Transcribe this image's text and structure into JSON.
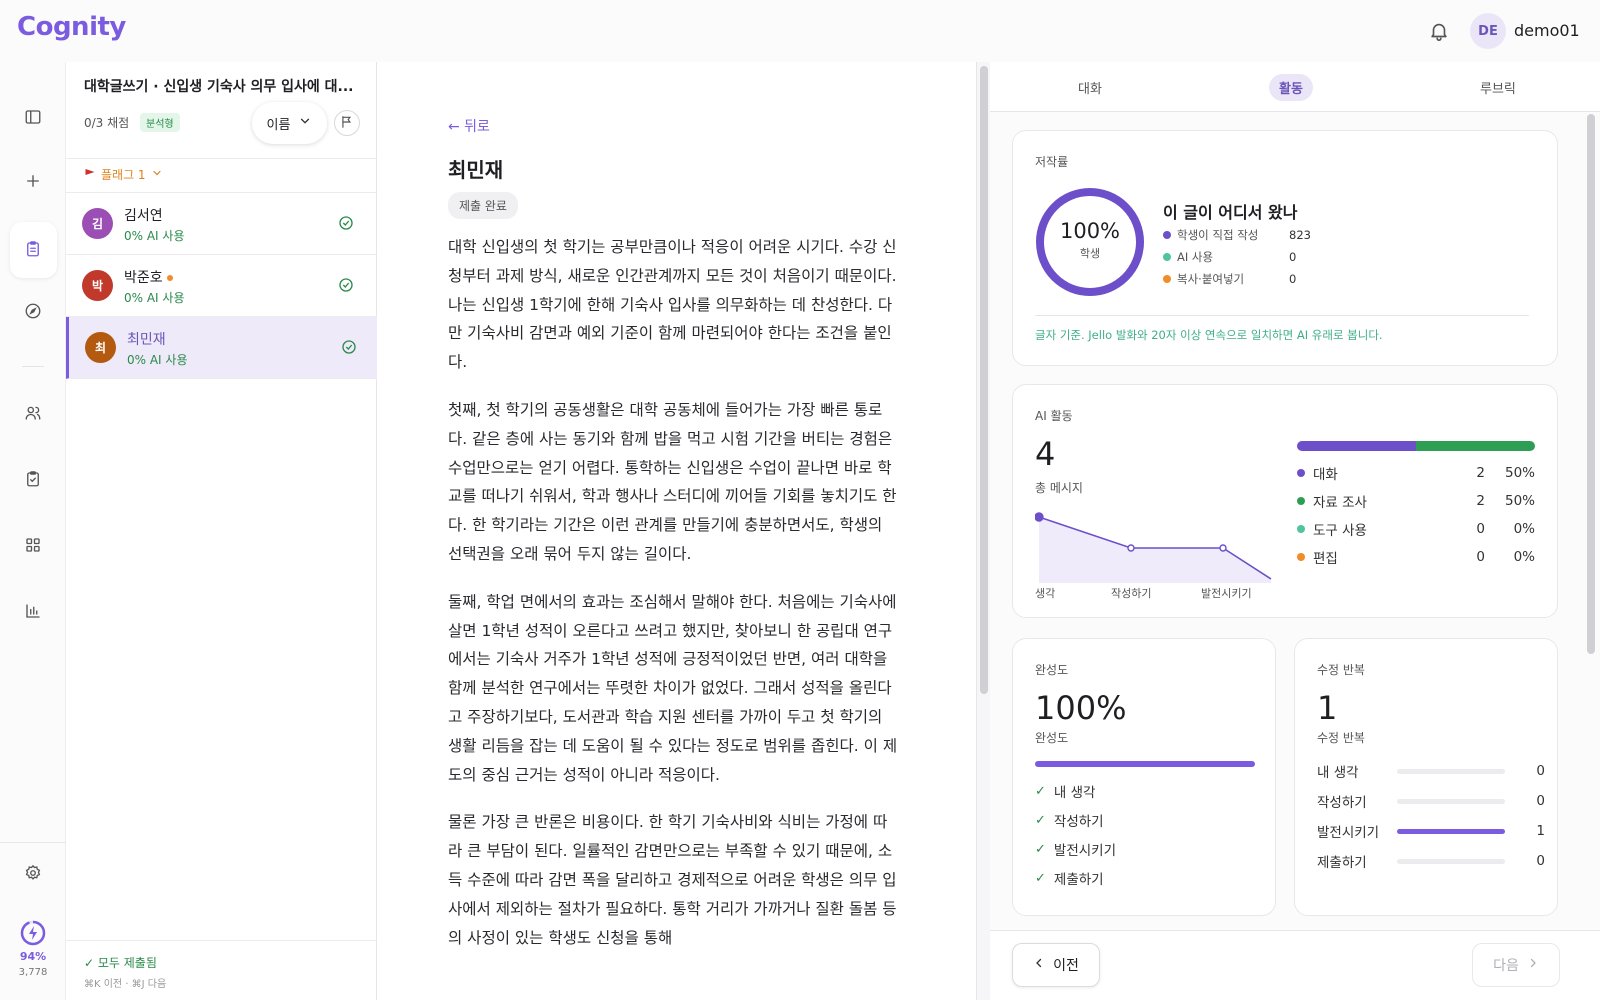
{
  "app": {
    "logo": "Cognity"
  },
  "header": {
    "user_initials": "DE",
    "username": "demo01",
    "bell_icon": "bell-icon"
  },
  "rail": {
    "icons": [
      "sidebar-toggle-icon",
      "plus-icon",
      "clipboard-icon",
      "compass-icon",
      "users-icon",
      "clipboard-check-icon",
      "grid-icon",
      "bar-chart-icon",
      "gear-icon",
      "lightning-icon"
    ],
    "usage_percent": "94%",
    "usage_count": "3,778"
  },
  "assignment": {
    "title": "대학글쓰기 · 신입생 기숙사 의무 입사에 대...",
    "grade_count": "0/3 채점",
    "type_badge": "분석형",
    "sort_label": "이름",
    "flag_filter": "플래그 1"
  },
  "students": [
    {
      "initial": "김",
      "name": "김서연",
      "ai": "0% AI 사용",
      "color": "#9b4fb5",
      "flagged": false,
      "active": false
    },
    {
      "initial": "박",
      "name": "박준호",
      "ai": "0% AI 사용",
      "color": "#c0392b",
      "flagged": true,
      "active": false
    },
    {
      "initial": "최",
      "name": "최민재",
      "ai": "0% AI 사용",
      "color": "#b35a10",
      "flagged": false,
      "active": true
    }
  ],
  "list_footer": {
    "status": "✓ 모두 제출됨",
    "hint": "⌘K 이전 · ⌘J 다음"
  },
  "essay": {
    "back_label": "← 뒤로",
    "student_name": "최민재",
    "status": "제출 완료",
    "paragraphs": [
      "대학 신입생의 첫 학기는 공부만큼이나 적응이 어려운 시기다. 수강 신청부터 과제 방식, 새로운 인간관계까지 모든 것이 처음이기 때문이다. 나는 신입생 1학기에 한해 기숙사 입사를 의무화하는 데 찬성한다. 다만 기숙사비 감면과 예외 기준이 함께 마련되어야 한다는 조건을 붙인다.",
      "첫째, 첫 학기의 공동생활은 대학 공동체에 들어가는 가장 빠른 통로다. 같은 층에 사는 동기와 함께 밥을 먹고 시험 기간을 버티는 경험은 수업만으로는 얻기 어렵다. 통학하는 신입생은 수업이 끝나면 바로 학교를 떠나기 쉬워서, 학과 행사나 스터디에 끼어들 기회를 놓치기도 한다. 한 학기라는 기간은 이런 관계를 만들기에 충분하면서도, 학생의 선택권을 오래 묶어 두지 않는 길이다.",
      "둘째, 학업 면에서의 효과는 조심해서 말해야 한다. 처음에는 기숙사에 살면 1학년 성적이 오른다고 쓰려고 했지만, 찾아보니 한 공립대 연구에서는 기숙사 거주가 1학년 성적에 긍정적이었던 반면, 여러 대학을 함께 분석한 연구에서는 뚜렷한 차이가 없었다. 그래서 성적을 올린다고 주장하기보다, 도서관과 학습 지원 센터를 가까이 두고 첫 학기의 생활 리듬을 잡는 데 도움이 될 수 있다는 정도로 범위를 좁힌다. 이 제도의 중심 근거는 성적이 아니라 적응이다.",
      "물론 가장 큰 반론은 비용이다. 한 학기 기숙사비와 식비는 가정에 따라 큰 부담이 된다. 일률적인 감면만으로는 부족할 수 있기 때문에, 소득 수준에 따라 감면 폭을 달리하고 경제적으로 어려운 학생은 의무 입사에서 제외하는 절차가 필요하다. 통학 거리가 가까거나 질환 돌봄 등의 사정이 있는 학생도 신청을 통해"
    ]
  },
  "tabs": [
    "대화",
    "활동",
    "루브릭"
  ],
  "active_tab": "활동",
  "authorship": {
    "label": "저작률",
    "percent": "100%",
    "percent_label": "학생",
    "title": "이 글이 어디서 왔나",
    "sources": [
      {
        "name": "학생이 직접 작성",
        "value": "823",
        "color": "#6c4fc9"
      },
      {
        "name": "AI 사용",
        "value": "0",
        "color": "#4fc4a0"
      },
      {
        "name": "복사·붙여넣기",
        "value": "0",
        "color": "#f08c2a"
      }
    ],
    "note": "글자 기준. Jello 발화와 20자 이상 연속으로 일치하면 AI 유래로 봅니다."
  },
  "ai_activity": {
    "label": "AI 활동",
    "total": "4",
    "total_label": "총 메시지",
    "stages": [
      "생각",
      "작성하기",
      "발전시키기"
    ],
    "legend": [
      {
        "name": "대화",
        "count": "2",
        "pct": "50%",
        "color": "#6c4fc9",
        "share": 0.5
      },
      {
        "name": "자료 조사",
        "count": "2",
        "pct": "50%",
        "color": "#2e9e55",
        "share": 0.5
      },
      {
        "name": "도구 사용",
        "count": "0",
        "pct": "0%",
        "color": "#4fc4a0",
        "share": 0
      },
      {
        "name": "편집",
        "count": "0",
        "pct": "0%",
        "color": "#f08c2a",
        "share": 0
      }
    ],
    "spark_values": [
      2,
      1,
      1,
      0
    ]
  },
  "completion": {
    "label": "완성도",
    "percent": "100%",
    "percent_label": "완성도",
    "fraction": 1.0,
    "steps": [
      "내 생각",
      "작성하기",
      "발전시키기",
      "제출하기"
    ]
  },
  "revisions": {
    "label": "수정 반복",
    "total": "1",
    "total_label": "수정 반복",
    "rows": [
      {
        "name": "내 생각",
        "value": "0",
        "fraction": 0
      },
      {
        "name": "작성하기",
        "value": "0",
        "fraction": 0
      },
      {
        "name": "발전시키기",
        "value": "1",
        "fraction": 1
      },
      {
        "name": "제출하기",
        "value": "0",
        "fraction": 0
      }
    ]
  },
  "footer": {
    "prev_label": "이전",
    "next_label": "다음"
  }
}
